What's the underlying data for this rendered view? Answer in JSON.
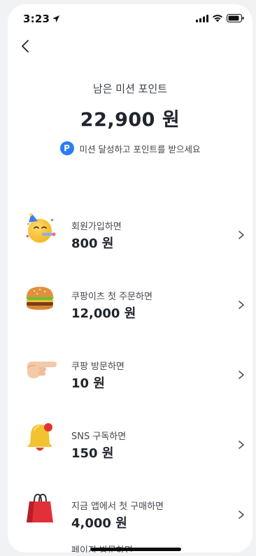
{
  "status": {
    "time": "3:23"
  },
  "header": {
    "subtitle": "남은 미션 포인트",
    "points": "22,900 원",
    "hint_badge": "P",
    "hint_text": "미션 달성하고 포인트를 받으세요"
  },
  "missions": [
    {
      "label": "회원가입하면",
      "amount": "800 원",
      "icon": "party-face-icon"
    },
    {
      "label": "쿠팡이츠 첫 주문하면",
      "amount": "12,000 원",
      "icon": "hamburger-icon"
    },
    {
      "label": "쿠팡 방문하면",
      "amount": "10 원",
      "icon": "pointing-hand-icon"
    },
    {
      "label": "SNS 구독하면",
      "amount": "150 원",
      "icon": "bell-icon"
    },
    {
      "label": "지금 앱에서 첫 구매하면",
      "amount": "4,000 원",
      "icon": "shopping-bag-icon"
    }
  ],
  "partial_item_label": "페이지 방문하면",
  "colors": {
    "accent": "#2c7df5",
    "background": "#ffffff",
    "frame": "#f1f2f4"
  }
}
